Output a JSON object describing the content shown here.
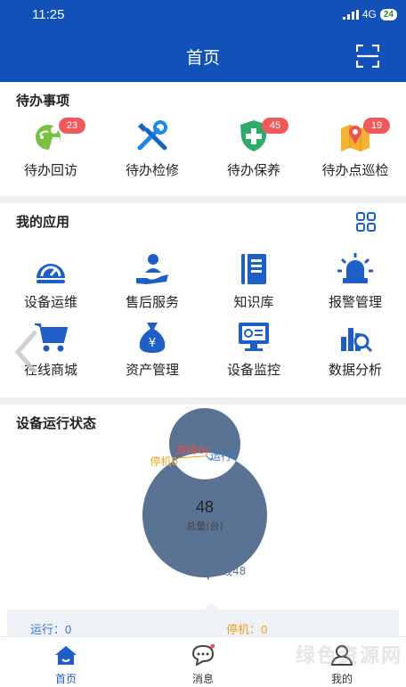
{
  "status": {
    "time": "11:25",
    "network": "4G",
    "battery": "24"
  },
  "header": {
    "title": "首页"
  },
  "todo": {
    "title": "待办事项",
    "items": [
      {
        "label": "待办回访",
        "badge": "23",
        "icon": "revisit-icon"
      },
      {
        "label": "待办检修",
        "badge": "",
        "icon": "repair-tools-icon"
      },
      {
        "label": "待办保养",
        "badge": "45",
        "icon": "maintenance-shield-icon"
      },
      {
        "label": "待办点巡检",
        "badge": "19",
        "icon": "map-inspection-icon"
      }
    ]
  },
  "apps": {
    "title": "我的应用",
    "items": [
      {
        "label": "设备运维"
      },
      {
        "label": "售后服务"
      },
      {
        "label": "知识库"
      },
      {
        "label": "报警管理"
      },
      {
        "label": "在线商城"
      },
      {
        "label": "资产管理"
      },
      {
        "label": "设备监控"
      },
      {
        "label": "数据分析"
      }
    ]
  },
  "device_status": {
    "title": "设备运行状态",
    "total": "48",
    "total_label": "总量(台)",
    "legend": {
      "fault": "故障0",
      "stopped": "停机0",
      "running": "运行0",
      "offline": "离线48"
    },
    "colors": {
      "ring": "#5a7294",
      "fault": "#e0534c",
      "stopped": "#f0a020",
      "running": "#3c78d0",
      "offline": "#5a7294"
    },
    "stats": {
      "running": "运行：0",
      "stopped": "停机：0"
    }
  },
  "chart_data": {
    "type": "pie",
    "categories": [
      "故障",
      "停机",
      "运行",
      "离线"
    ],
    "values": [
      0,
      0,
      0,
      48
    ],
    "title": "设备运行状态"
  },
  "tabs": [
    {
      "label": "首页",
      "active": true
    },
    {
      "label": "消息",
      "active": false
    },
    {
      "label": "我的",
      "active": false
    }
  ],
  "watermark": "绿色资源网"
}
